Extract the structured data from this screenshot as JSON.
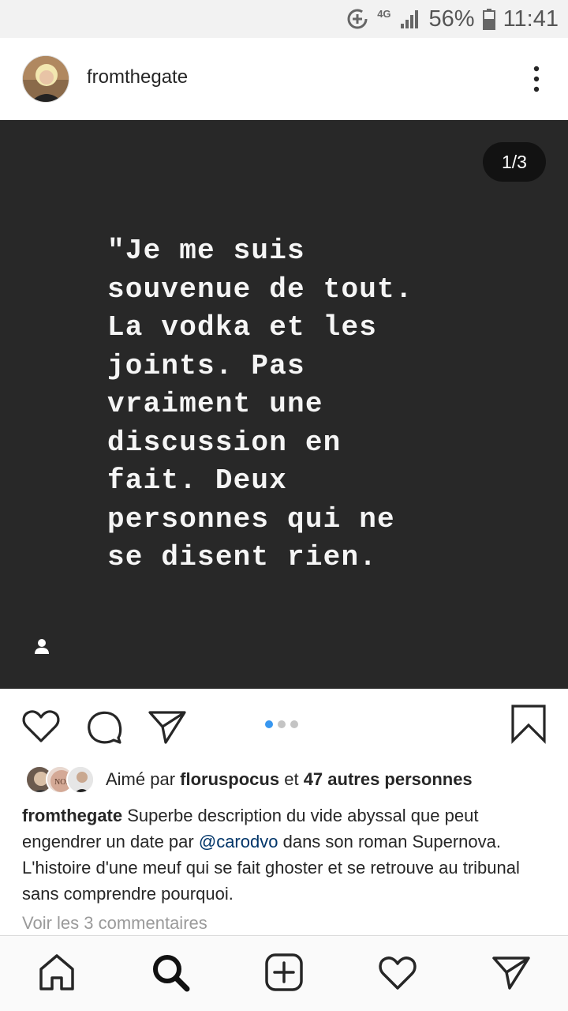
{
  "status_bar": {
    "network": "4G",
    "battery": "56%",
    "time": "11:41"
  },
  "post": {
    "username": "fromthegate",
    "counter": "1/3",
    "quote": "\"Je me suis\nsouvenue de tout.\nLa vodka et les\njoints. Pas\nvraiment une\ndiscussion en\nfait. Deux\npersonnes qui ne\nse disent rien.",
    "carousel_position": 1,
    "carousel_total": 3
  },
  "likes": {
    "prefix": "Aimé par",
    "user": "floruspocus",
    "middle": "et",
    "others": "47 autres personnes"
  },
  "caption": {
    "username": "fromthegate",
    "text_before": "Superbe description du vide abyssal que peut engendrer un date par",
    "mention": "@carodvo",
    "text_after": "dans son roman Supernova. L'histoire d'une meuf qui se fait ghoster et se retrouve au tribunal sans comprendre pourquoi."
  },
  "comments_link": "Voir les 3 commentaires",
  "icons": {
    "like": "heart-icon",
    "comment": "comment-icon",
    "share": "send-icon",
    "save": "bookmark-icon",
    "nav": [
      "home-icon",
      "search-icon",
      "add-icon",
      "activity-icon",
      "direct-icon"
    ]
  },
  "colors": {
    "accent": "#3897f0",
    "mention": "#003569",
    "post_bg": "#282828"
  }
}
